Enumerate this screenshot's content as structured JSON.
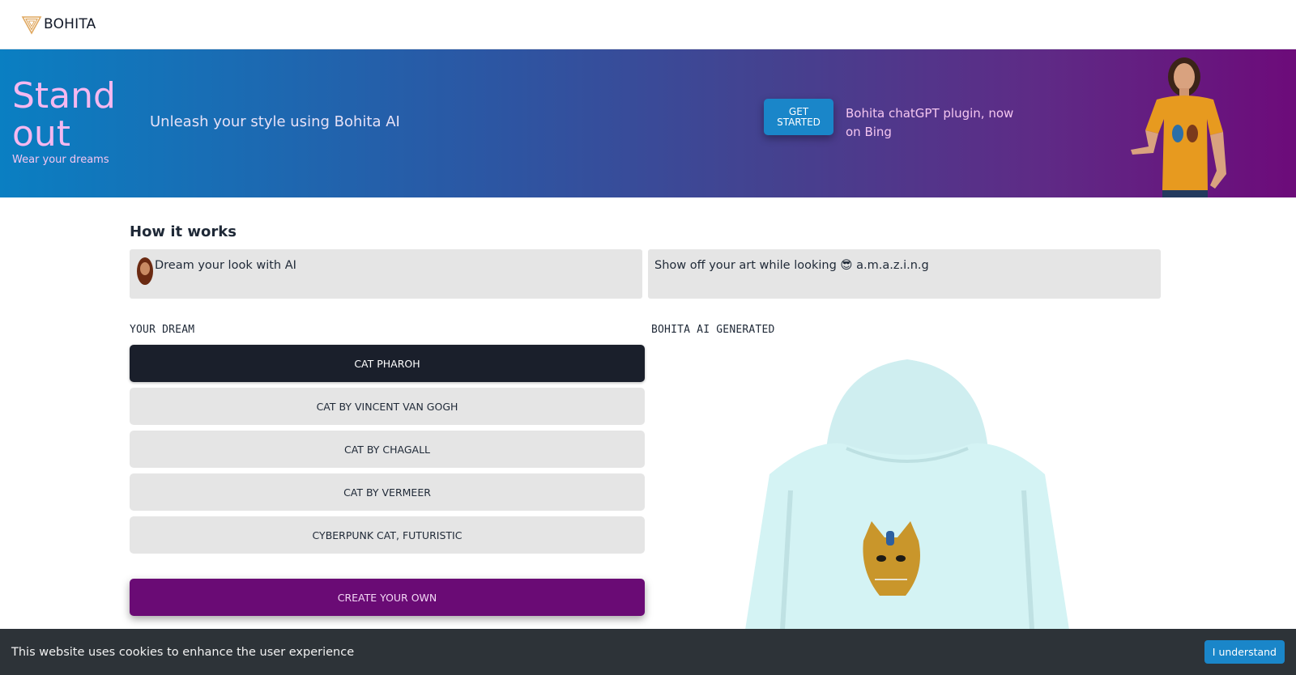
{
  "header": {
    "logo_text": "BOHITA",
    "logo_icon": "bohita-v-logo-icon"
  },
  "hero": {
    "title": "Stand out",
    "subtitle": "Wear your dreams",
    "tagline": "Unleash your style using Bohita AI",
    "cta_label": "GET STARTED",
    "plugin_text": "Bohita chatGPT plugin, now on Bing",
    "gradient_start": "#0a7fc2",
    "gradient_end": "#6d0b7a",
    "title_color": "#f5b8f0"
  },
  "how": {
    "title": "How it works",
    "step1": "Dream your look with AI",
    "step2": "Show off your art while looking 😎 a.m.a.z.i.n.g"
  },
  "dream": {
    "label": "YOUR DREAM",
    "items": [
      {
        "label": "CAT PHAROH",
        "active": true
      },
      {
        "label": "CAT BY VINCENT VAN GOGH",
        "active": false
      },
      {
        "label": "CAT BY CHAGALL",
        "active": false
      },
      {
        "label": "CAT BY VERMEER",
        "active": false
      },
      {
        "label": "CYBERPUNK CAT, FUTURISTIC",
        "active": false
      }
    ],
    "create_label": "CREATE YOUR OWN"
  },
  "generated": {
    "label": "BOHITA AI GENERATED",
    "garment_color": "#d4f3f4"
  },
  "cookie": {
    "text": "This website uses cookies to enhance the user experience",
    "button_label": "I understand"
  },
  "colors": {
    "accent_blue": "#1a86c9",
    "accent_purple": "#6a0b75",
    "dark_button": "#1a1f2b"
  }
}
